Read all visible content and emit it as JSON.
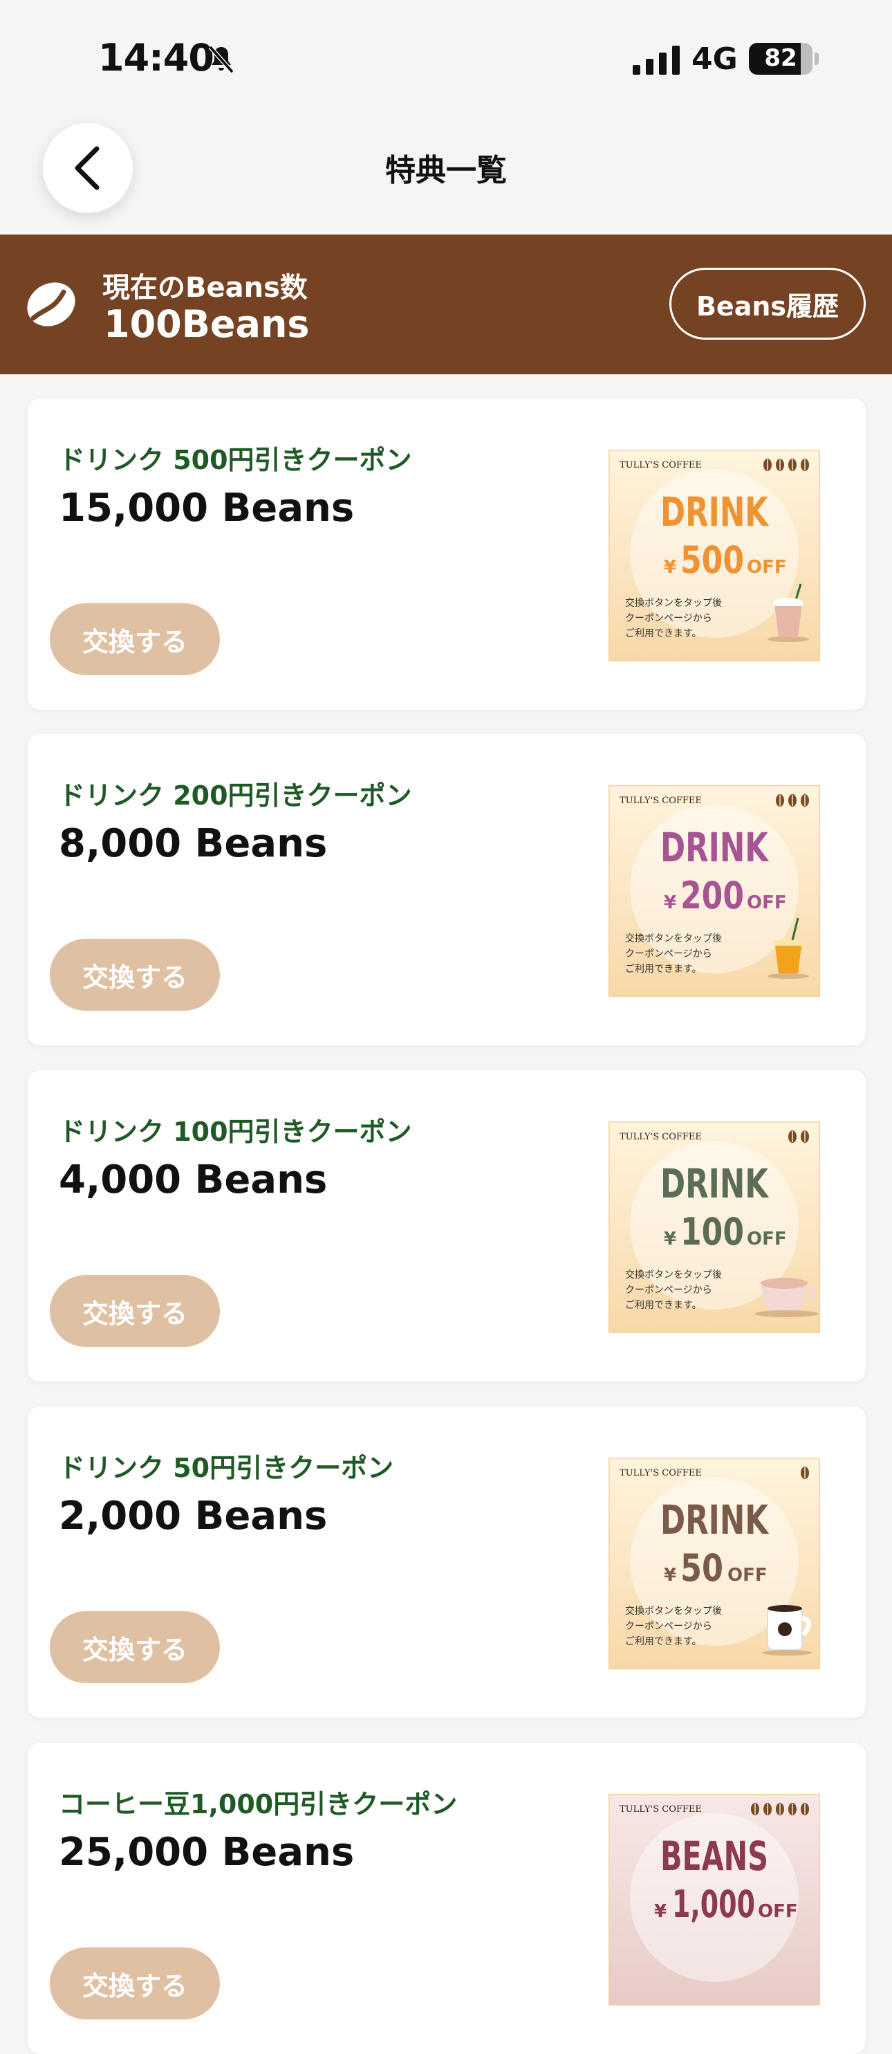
{
  "status_bar": {
    "time": "14:40",
    "network": "4G",
    "battery": "82",
    "battery_level": 0.82
  },
  "header": {
    "title": "特典一覧"
  },
  "beans": {
    "label": "現在のBeans数",
    "count": "100Beans",
    "history_button": "Beans履歴"
  },
  "colors": {
    "brand_brown": "#754223",
    "button_tan": "#dfc0a2",
    "coupon_name_green": "#1f5a26"
  },
  "coupons": [
    {
      "name": "ドリンク 500円引きクーポン",
      "cost": "15,000 Beans",
      "button": "交換する",
      "image": {
        "brand": "TULLY'S COFFEE",
        "headline": "DRINK",
        "yen": "¥",
        "amount": "500",
        "off": "OFF",
        "note1": "交換ボタンをタップ後",
        "note2": "クーポンページから",
        "note3": "ご利用できます。",
        "beans_icons": 4,
        "color": "#ef9231",
        "bg_from": "#fff4de",
        "bg_to": "#f8d8a8",
        "cup": "frappe-icon"
      }
    },
    {
      "name": "ドリンク 200円引きクーポン",
      "cost": "8,000 Beans",
      "button": "交換する",
      "image": {
        "brand": "TULLY'S COFFEE",
        "headline": "DRINK",
        "yen": "¥",
        "amount": "200",
        "off": "OFF",
        "note1": "交換ボタンをタップ後",
        "note2": "クーポンページから",
        "note3": "ご利用できます。",
        "beans_icons": 3,
        "color": "#a65493",
        "bg_from": "#fff4de",
        "bg_to": "#f8d8a8",
        "cup": "juice-icon"
      }
    },
    {
      "name": "ドリンク 100円引きクーポン",
      "cost": "4,000 Beans",
      "button": "交換する",
      "image": {
        "brand": "TULLY'S COFFEE",
        "headline": "DRINK",
        "yen": "¥",
        "amount": "100",
        "off": "OFF",
        "note1": "交換ボタンをタップ後",
        "note2": "クーポンページから",
        "note3": "ご利用できます。",
        "beans_icons": 2,
        "color": "#5b6d54",
        "bg_from": "#fff4de",
        "bg_to": "#f8d8a8",
        "cup": "latte-cup-icon"
      }
    },
    {
      "name": "ドリンク 50円引きクーポン",
      "cost": "2,000 Beans",
      "button": "交換する",
      "image": {
        "brand": "TULLY'S COFFEE",
        "headline": "DRINK",
        "yen": "¥",
        "amount": "50",
        "off": "OFF",
        "note1": "交換ボタンをタップ後",
        "note2": "クーポンページから",
        "note3": "ご利用できます。",
        "beans_icons": 1,
        "color": "#7a5b4a",
        "bg_from": "#fff4de",
        "bg_to": "#f8d8a8",
        "cup": "coffee-mug-icon"
      }
    },
    {
      "name": "コーヒー豆1,000円引きクーポン",
      "cost": "25,000 Beans",
      "button": "交換する",
      "image": {
        "brand": "TULLY'S COFFEE",
        "headline": "BEANS",
        "yen": "¥",
        "amount": "1,000",
        "off": "OFF",
        "note1": "",
        "note2": "",
        "note3": "",
        "beans_icons": 5,
        "color": "#8c3a4e",
        "bg_from": "#f7e8e6",
        "bg_to": "#e7cbc6",
        "cup": ""
      }
    }
  ]
}
